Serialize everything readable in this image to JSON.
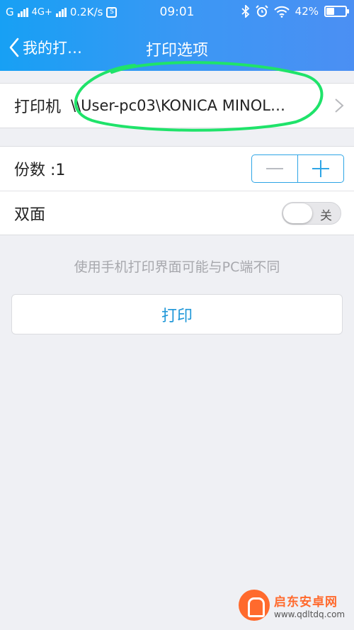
{
  "status_bar": {
    "carrier1": "G",
    "network": "4G+",
    "speed": "0.2K/s",
    "time": "09:01",
    "battery_text": "42%",
    "battery_level": 0.42,
    "icons": [
      "signal-icon",
      "bluetooth-icon",
      "alarm-icon",
      "wifi-icon",
      "battery-icon"
    ]
  },
  "nav": {
    "back_label": "我的打…",
    "title": "打印选项"
  },
  "printer": {
    "label": "打印机",
    "value": "\\\\User-pc03\\KONICA MINOL…"
  },
  "copies": {
    "label": "份数 :1",
    "minus": "−",
    "plus": "+"
  },
  "duplex": {
    "label": "双面",
    "toggle_text": "关",
    "on": false
  },
  "hint": "使用手机打印界面可能与PC端不同",
  "print_button": "打印",
  "watermark": {
    "title": "启东安卓网",
    "url": "www.qdltdq.com"
  },
  "colors": {
    "header_start": "#17a0f4",
    "header_end": "#4b8ff3",
    "accent": "#2ea5e6",
    "annotation": "#1fe36a",
    "background": "#eff0f4"
  }
}
